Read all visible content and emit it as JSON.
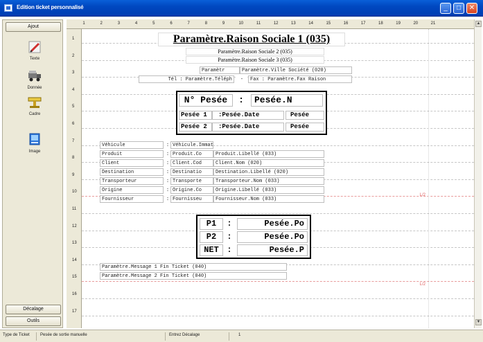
{
  "window": {
    "title": "Edition ticket personnalisé",
    "buttons": [
      "minimize",
      "maximize",
      "close"
    ]
  },
  "leftbar": {
    "top_button": "Ajout",
    "tools": [
      {
        "label": "Texte",
        "icon": "pencil-icon"
      },
      {
        "label": "Donnée",
        "icon": "truck-icon"
      },
      {
        "label": "Cadre",
        "icon": "frame-icon"
      },
      {
        "label": "Image",
        "icon": "image-icon"
      }
    ],
    "bottom_buttons": [
      "Décalage",
      "Outils"
    ]
  },
  "ruler": {
    "columns": [
      "1",
      "2",
      "3",
      "4",
      "5",
      "6",
      "7",
      "8",
      "9",
      "10",
      "11",
      "12",
      "13",
      "14",
      "15",
      "16",
      "17",
      "18",
      "19",
      "20",
      "21"
    ],
    "rows": [
      "1",
      "2",
      "3",
      "4",
      "5",
      "6",
      "7",
      "8",
      "9",
      "10",
      "11",
      "12",
      "13",
      "14",
      "15",
      "16",
      "17"
    ]
  },
  "ticket": {
    "title": "Paramètre.Raison Sociale 1 (035)",
    "sub2": "Paramètre.Raison Sociale 2 (035)",
    "sub3": "Paramètre.Raison Sociale 3 (035)",
    "city_left": "Paramètr",
    "city_right": "Paramètre.Ville Société (020)",
    "tel_label": "Tél : Paramètre.Téléph",
    "tel_sep": "-",
    "fax": "Fax : Paramètre.Fax Raison",
    "weigh_title_left": "N° Pesée",
    "weigh_title_sep": ":",
    "weigh_title_right": "Pesée.N",
    "pesee1": [
      "Pesée 1",
      ":Pesée.Date",
      "Pesée"
    ],
    "pesee2": [
      "Pesée 2",
      ":Pesée.Date",
      "Pesée"
    ],
    "fields": [
      {
        "label": "Véhicule",
        "sep": ":",
        "code": "Véhicule.Immatr",
        "name": ""
      },
      {
        "label": "Produit",
        "sep": ":",
        "code": "Produit.Co",
        "name": "Produit.Libellé (033)"
      },
      {
        "label": "Client",
        "sep": ":",
        "code": "Client.Cod",
        "name": "Client.Nom (020)"
      },
      {
        "label": "Destination",
        "sep": ":",
        "code": "Destinatio",
        "name": "Destination.Libellé (020)"
      },
      {
        "label": "Transporteur",
        "sep": ":",
        "code": "Transporte",
        "name": "Transporteur.Nom (033)"
      },
      {
        "label": "Origine",
        "sep": ":",
        "code": "Origine.Co",
        "name": "Origine.Libellé (033)"
      },
      {
        "label": "Fournisseur",
        "sep": ":",
        "code": "Fournisseu",
        "name": "Fournisseur.Nom (033)"
      }
    ],
    "weights": [
      {
        "label": "P1",
        "sep": ":",
        "value": "Pesée.Po"
      },
      {
        "label": "P2",
        "sep": ":",
        "value": "Pesée.Po"
      },
      {
        "label": "NET",
        "sep": ":",
        "value": "Pesée.P"
      }
    ],
    "message1": "Paramètre.Message 1 Fin Ticket (040)",
    "message2": "Paramètre.Message 2 Fin Ticket (040)",
    "margin_mark_1": "L/2",
    "margin_mark_2": "L/2"
  },
  "statusbar": {
    "type_label": "Type de Ticket",
    "type_value": "Pesée de sortie manuelle",
    "decalage_label": "Entrez Décalage",
    "decalage_value": "1"
  },
  "colors": {
    "titlebar": "#0048c0",
    "panel": "#ece9d8",
    "grid": "#c6c6c6",
    "margin_line": "#e89a9a"
  }
}
